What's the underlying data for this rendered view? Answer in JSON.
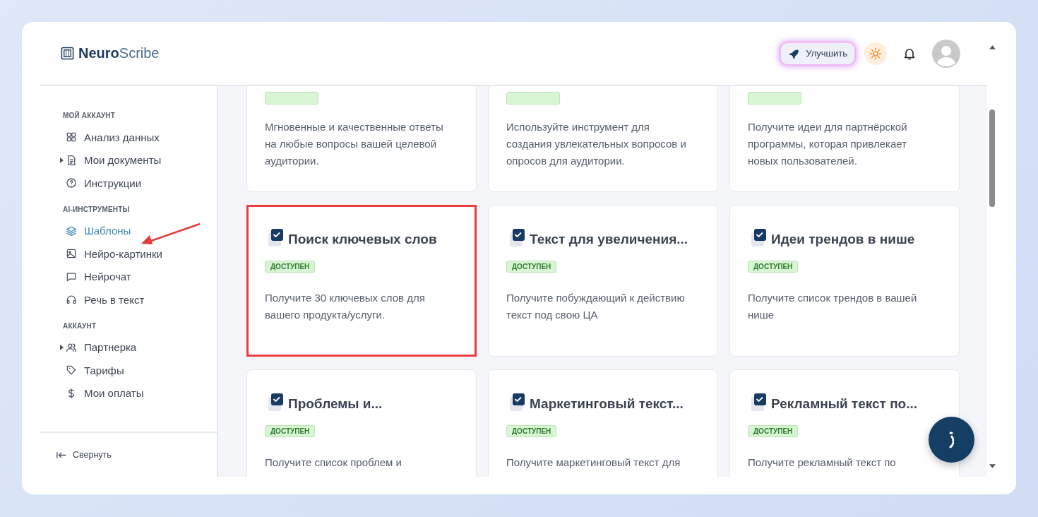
{
  "header": {
    "logo": {
      "bold": "Neuro",
      "light": "Scribe"
    },
    "upgrade_button": "Улучшить"
  },
  "sidebar": {
    "sections": [
      {
        "title": "МОЙ АККАУНТ",
        "items": [
          {
            "label": "Анализ данных",
            "expandable": false,
            "selected": false
          },
          {
            "label": "Мои документы",
            "expandable": true,
            "selected": false
          },
          {
            "label": "Инструкции",
            "expandable": false,
            "selected": false
          }
        ]
      },
      {
        "title": "AI-ИНСТРУМЕНТЫ",
        "items": [
          {
            "label": "Шаблоны",
            "expandable": false,
            "selected": true
          },
          {
            "label": "Нейро-картинки",
            "expandable": false,
            "selected": false
          },
          {
            "label": "Нейрочат",
            "expandable": false,
            "selected": false
          },
          {
            "label": "Речь в текст",
            "expandable": false,
            "selected": false
          }
        ]
      },
      {
        "title": "АККАУНТ",
        "items": [
          {
            "label": "Партнерка",
            "expandable": true,
            "selected": false
          },
          {
            "label": "Тарифы",
            "expandable": false,
            "selected": false
          },
          {
            "label": "Мои оплаты",
            "expandable": false,
            "selected": false
          }
        ]
      }
    ],
    "collapse_button": "Свернуть"
  },
  "cards": [
    {
      "kind": "clipped",
      "description": "Мгновенные и качественные ответы на любые вопросы вашей целевой аудитории.",
      "highlighted": false
    },
    {
      "kind": "clipped",
      "description": "Используйте инструмент для создания увлекательных вопросов и опросов для аудитории.",
      "highlighted": false
    },
    {
      "kind": "clipped",
      "description": "Получите идеи для партнёрской программы, которая привлекает новых пользователей.",
      "highlighted": false
    },
    {
      "kind": "full",
      "title": "Поиск ключевых слов",
      "badge": "ДОСТУПЕН",
      "description": "Получите 30 ключевых слов для вашего продукта/услуги.",
      "highlighted": true
    },
    {
      "kind": "full",
      "title": "Текст для увеличения...",
      "badge": "ДОСТУПЕН",
      "description": "Получите побуждающий к действию текст под свою ЦА",
      "highlighted": false
    },
    {
      "kind": "full",
      "title": "Идеи трендов в нише",
      "badge": "ДОСТУПЕН",
      "description": "Получите список трендов в вашей нише",
      "highlighted": false
    },
    {
      "kind": "full",
      "title": "Проблемы и...",
      "badge": "ДОСТУПЕН",
      "description": "Получите список проблем и",
      "highlighted": false
    },
    {
      "kind": "full",
      "title": "Маркетинговый текст...",
      "badge": "ДОСТУПЕН",
      "description": "Получите маркетинговый текст для",
      "highlighted": false
    },
    {
      "kind": "full",
      "title": "Рекламный текст по...",
      "badge": "ДОСТУПЕН",
      "description": "Получите рекламный текст по",
      "highlighted": false
    }
  ]
}
